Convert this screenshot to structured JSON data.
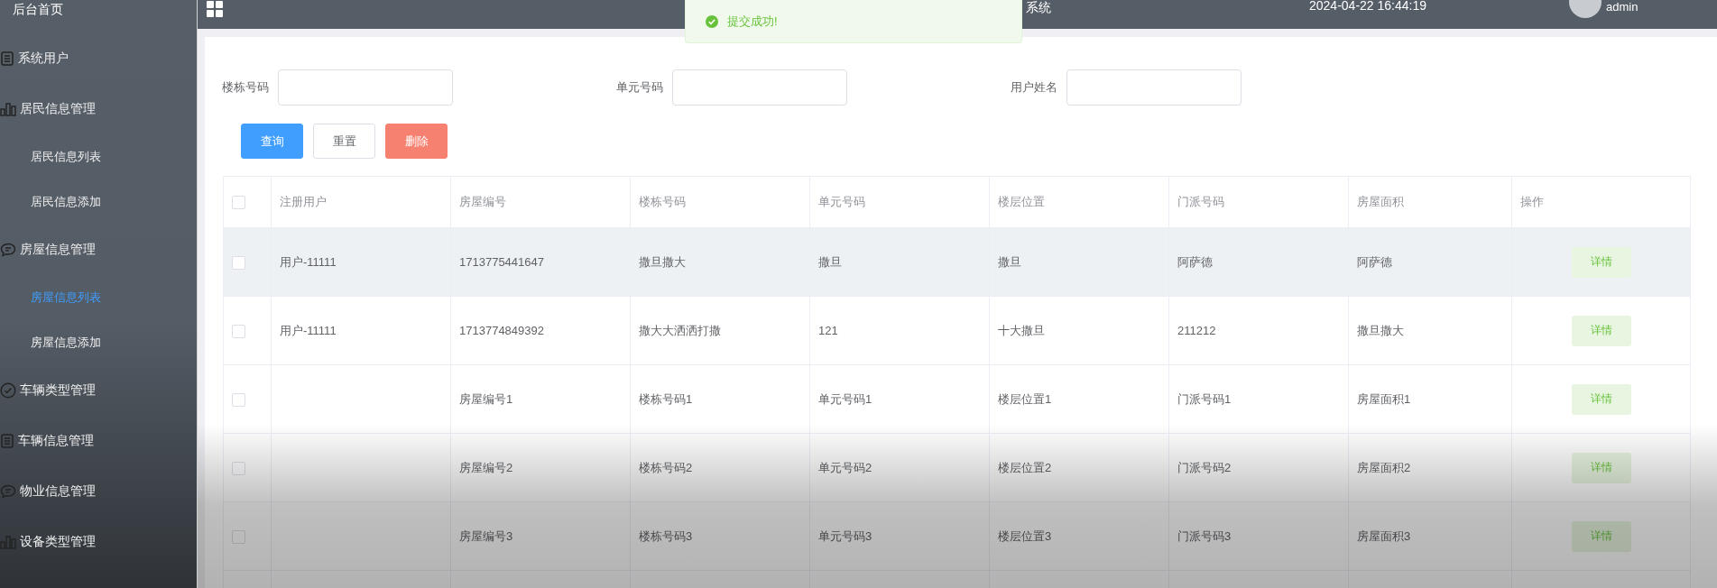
{
  "sidebar": {
    "home": "后台首页",
    "items": [
      {
        "label": "系统用户",
        "kind": "doc",
        "selected": false
      },
      {
        "label": "居民信息管理",
        "kind": "bars",
        "selected": false,
        "children": [
          {
            "label": "居民信息列表",
            "selected": false
          },
          {
            "label": "居民信息添加",
            "selected": false
          }
        ]
      },
      {
        "label": "房屋信息管理",
        "kind": "chat",
        "selected": false,
        "children": [
          {
            "label": "房屋信息列表",
            "selected": true
          },
          {
            "label": "房屋信息添加",
            "selected": false
          }
        ]
      },
      {
        "label": "车辆类型管理",
        "kind": "check",
        "selected": false
      },
      {
        "label": "车辆信息管理",
        "kind": "doc",
        "selected": false
      },
      {
        "label": "物业信息管理",
        "kind": "chat",
        "selected": false
      },
      {
        "label": "设备类型管理",
        "kind": "bars",
        "selected": false
      }
    ]
  },
  "header": {
    "title": "系统",
    "datetime": "2024-04-22 16:44:19",
    "user": "admin"
  },
  "toast": {
    "message": "提交成功!"
  },
  "search": {
    "fields": [
      {
        "label": "楼栋号码"
      },
      {
        "label": "单元号码"
      },
      {
        "label": "用户姓名"
      }
    ],
    "buttons": [
      {
        "label": "查询",
        "kind": "primary"
      },
      {
        "label": "重置",
        "kind": "default"
      },
      {
        "label": "删除",
        "kind": "danger"
      }
    ]
  },
  "table": {
    "all_checked": false,
    "columns": [
      "注册用户",
      "房屋编号",
      "楼栋号码",
      "单元号码",
      "楼层位置",
      "门派号码",
      "房屋面积",
      "操作"
    ],
    "rows": [
      {
        "checked": false,
        "selected": true,
        "cells": [
          "用户-11111",
          "1713775441647",
          "撒旦撒大",
          "撒旦",
          "撒旦",
          "阿萨德",
          "阿萨德"
        ],
        "action": "详情"
      },
      {
        "checked": false,
        "selected": false,
        "cells": [
          "用户-11111",
          "1713774849392",
          "撒大大洒洒打撒",
          "121",
          "十大撒旦",
          "211212",
          "撒旦撒大"
        ],
        "action": "详情"
      },
      {
        "checked": false,
        "selected": false,
        "cells": [
          "",
          "房屋编号1",
          "楼栋号码1",
          "单元号码1",
          "楼层位置1",
          "门派号码1",
          "房屋面积1"
        ],
        "action": "详情"
      },
      {
        "checked": false,
        "selected": false,
        "cells": [
          "",
          "房屋编号2",
          "楼栋号码2",
          "单元号码2",
          "楼层位置2",
          "门派号码2",
          "房屋面积2"
        ],
        "action": "详情"
      },
      {
        "checked": false,
        "selected": false,
        "cells": [
          "",
          "房屋编号3",
          "楼栋号码3",
          "单元号码3",
          "楼层位置3",
          "门派号码3",
          "房屋面积3"
        ],
        "action": "详情"
      }
    ]
  }
}
